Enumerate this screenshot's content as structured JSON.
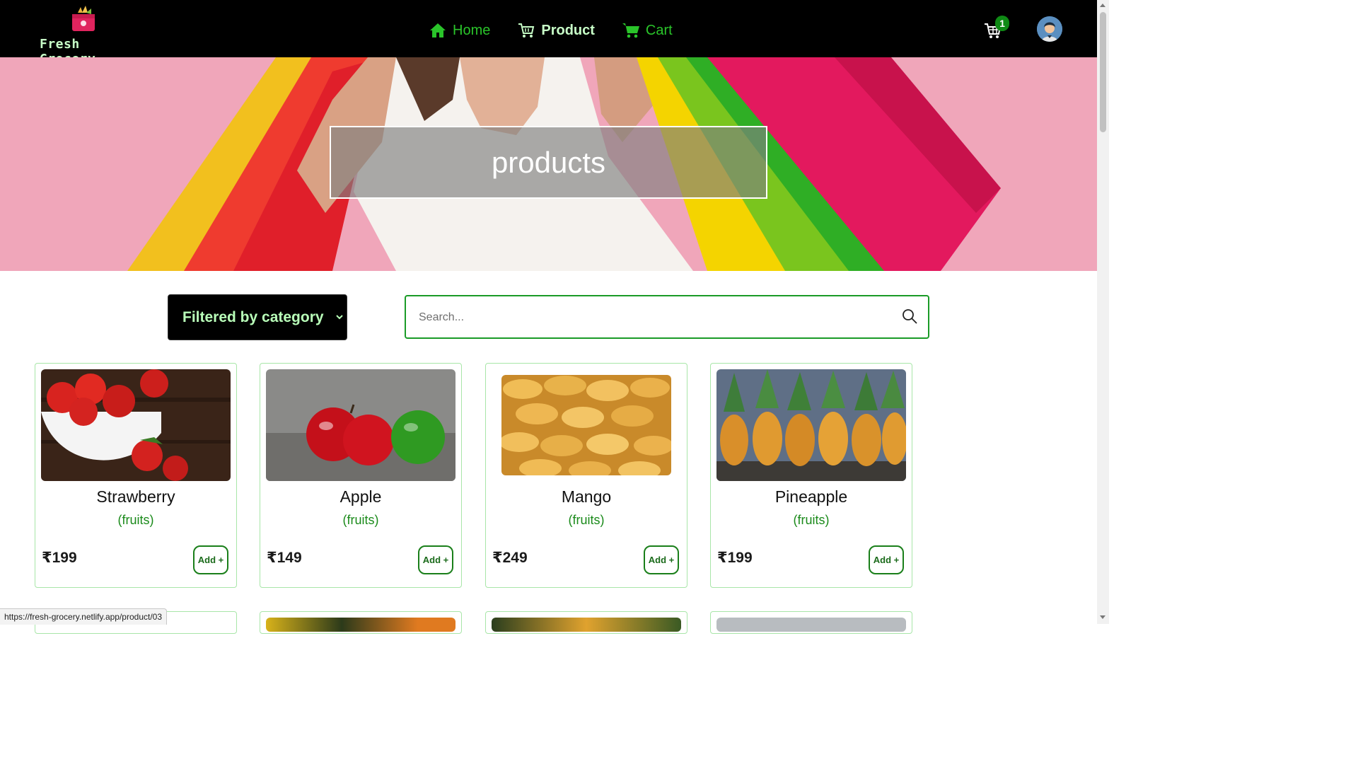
{
  "nav": {
    "logo_text": "Fresh Grocery",
    "links": [
      {
        "label": "Home",
        "icon": "home-icon"
      },
      {
        "label": "Product",
        "icon": "shopping-cart-outline-icon"
      },
      {
        "label": "Cart",
        "icon": "cart-icon"
      }
    ],
    "cart_count": "1",
    "colors": {
      "link": "#2ac42a",
      "active": "#c8ffc8",
      "bg": "#000000",
      "badge": "#0f8a15"
    }
  },
  "hero": {
    "title": "products"
  },
  "filters": {
    "category_label": "Filtered by category",
    "search_placeholder": "Search..."
  },
  "products": [
    {
      "name": "Strawberry",
      "category": "(fruits)",
      "price": "₹199",
      "add_label": "Add +"
    },
    {
      "name": "Apple",
      "category": "(fruits)",
      "price": "₹149",
      "add_label": "Add +"
    },
    {
      "name": "Mango",
      "category": "(fruits)",
      "price": "₹249",
      "add_label": "Add +"
    },
    {
      "name": "Pineapple",
      "category": "(fruits)",
      "price": "₹199",
      "add_label": "Add +"
    }
  ],
  "status_bar": {
    "url": "https://fresh-grocery.netlify.app/product/03"
  }
}
